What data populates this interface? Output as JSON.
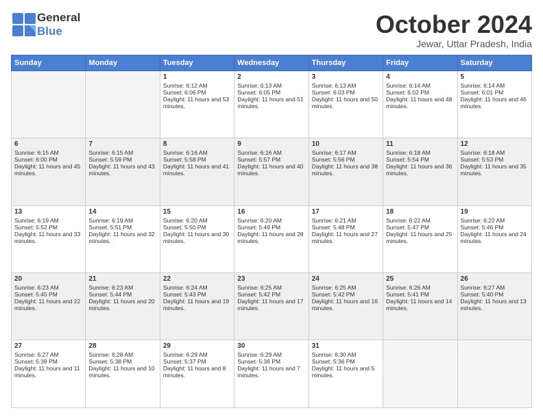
{
  "logo": {
    "general": "General",
    "blue": "Blue"
  },
  "header": {
    "month": "October 2024",
    "location": "Jewar, Uttar Pradesh, India"
  },
  "days": [
    "Sunday",
    "Monday",
    "Tuesday",
    "Wednesday",
    "Thursday",
    "Friday",
    "Saturday"
  ],
  "weeks": [
    [
      {
        "day": "",
        "data": ""
      },
      {
        "day": "",
        "data": ""
      },
      {
        "day": "1",
        "data": "Sunrise: 6:12 AM\nSunset: 6:06 PM\nDaylight: 11 hours and 53 minutes."
      },
      {
        "day": "2",
        "data": "Sunrise: 6:13 AM\nSunset: 6:05 PM\nDaylight: 11 hours and 51 minutes."
      },
      {
        "day": "3",
        "data": "Sunrise: 6:13 AM\nSunset: 6:03 PM\nDaylight: 11 hours and 50 minutes."
      },
      {
        "day": "4",
        "data": "Sunrise: 6:14 AM\nSunset: 6:02 PM\nDaylight: 11 hours and 48 minutes."
      },
      {
        "day": "5",
        "data": "Sunrise: 6:14 AM\nSunset: 6:01 PM\nDaylight: 11 hours and 46 minutes."
      }
    ],
    [
      {
        "day": "6",
        "data": "Sunrise: 6:15 AM\nSunset: 6:00 PM\nDaylight: 11 hours and 45 minutes."
      },
      {
        "day": "7",
        "data": "Sunrise: 6:15 AM\nSunset: 5:59 PM\nDaylight: 11 hours and 43 minutes."
      },
      {
        "day": "8",
        "data": "Sunrise: 6:16 AM\nSunset: 5:58 PM\nDaylight: 11 hours and 41 minutes."
      },
      {
        "day": "9",
        "data": "Sunrise: 6:16 AM\nSunset: 5:57 PM\nDaylight: 11 hours and 40 minutes."
      },
      {
        "day": "10",
        "data": "Sunrise: 6:17 AM\nSunset: 5:56 PM\nDaylight: 11 hours and 38 minutes."
      },
      {
        "day": "11",
        "data": "Sunrise: 6:18 AM\nSunset: 5:54 PM\nDaylight: 11 hours and 36 minutes."
      },
      {
        "day": "12",
        "data": "Sunrise: 6:18 AM\nSunset: 5:53 PM\nDaylight: 11 hours and 35 minutes."
      }
    ],
    [
      {
        "day": "13",
        "data": "Sunrise: 6:19 AM\nSunset: 5:52 PM\nDaylight: 11 hours and 33 minutes."
      },
      {
        "day": "14",
        "data": "Sunrise: 6:19 AM\nSunset: 5:51 PM\nDaylight: 11 hours and 32 minutes."
      },
      {
        "day": "15",
        "data": "Sunrise: 6:20 AM\nSunset: 5:50 PM\nDaylight: 11 hours and 30 minutes."
      },
      {
        "day": "16",
        "data": "Sunrise: 6:20 AM\nSunset: 5:49 PM\nDaylight: 11 hours and 28 minutes."
      },
      {
        "day": "17",
        "data": "Sunrise: 6:21 AM\nSunset: 5:48 PM\nDaylight: 11 hours and 27 minutes."
      },
      {
        "day": "18",
        "data": "Sunrise: 6:22 AM\nSunset: 5:47 PM\nDaylight: 11 hours and 25 minutes."
      },
      {
        "day": "19",
        "data": "Sunrise: 6:22 AM\nSunset: 5:46 PM\nDaylight: 11 hours and 24 minutes."
      }
    ],
    [
      {
        "day": "20",
        "data": "Sunrise: 6:23 AM\nSunset: 5:45 PM\nDaylight: 11 hours and 22 minutes."
      },
      {
        "day": "21",
        "data": "Sunrise: 6:23 AM\nSunset: 5:44 PM\nDaylight: 11 hours and 20 minutes."
      },
      {
        "day": "22",
        "data": "Sunrise: 6:24 AM\nSunset: 5:43 PM\nDaylight: 11 hours and 19 minutes."
      },
      {
        "day": "23",
        "data": "Sunrise: 6:25 AM\nSunset: 5:42 PM\nDaylight: 11 hours and 17 minutes."
      },
      {
        "day": "24",
        "data": "Sunrise: 6:25 AM\nSunset: 5:42 PM\nDaylight: 11 hours and 16 minutes."
      },
      {
        "day": "25",
        "data": "Sunrise: 6:26 AM\nSunset: 5:41 PM\nDaylight: 11 hours and 14 minutes."
      },
      {
        "day": "26",
        "data": "Sunrise: 6:27 AM\nSunset: 5:40 PM\nDaylight: 11 hours and 13 minutes."
      }
    ],
    [
      {
        "day": "27",
        "data": "Sunrise: 6:27 AM\nSunset: 5:39 PM\nDaylight: 11 hours and 11 minutes."
      },
      {
        "day": "28",
        "data": "Sunrise: 6:28 AM\nSunset: 5:38 PM\nDaylight: 11 hours and 10 minutes."
      },
      {
        "day": "29",
        "data": "Sunrise: 6:29 AM\nSunset: 5:37 PM\nDaylight: 11 hours and 8 minutes."
      },
      {
        "day": "30",
        "data": "Sunrise: 6:29 AM\nSunset: 5:36 PM\nDaylight: 11 hours and 7 minutes."
      },
      {
        "day": "31",
        "data": "Sunrise: 6:30 AM\nSunset: 5:36 PM\nDaylight: 11 hours and 5 minutes."
      },
      {
        "day": "",
        "data": ""
      },
      {
        "day": "",
        "data": ""
      }
    ]
  ]
}
